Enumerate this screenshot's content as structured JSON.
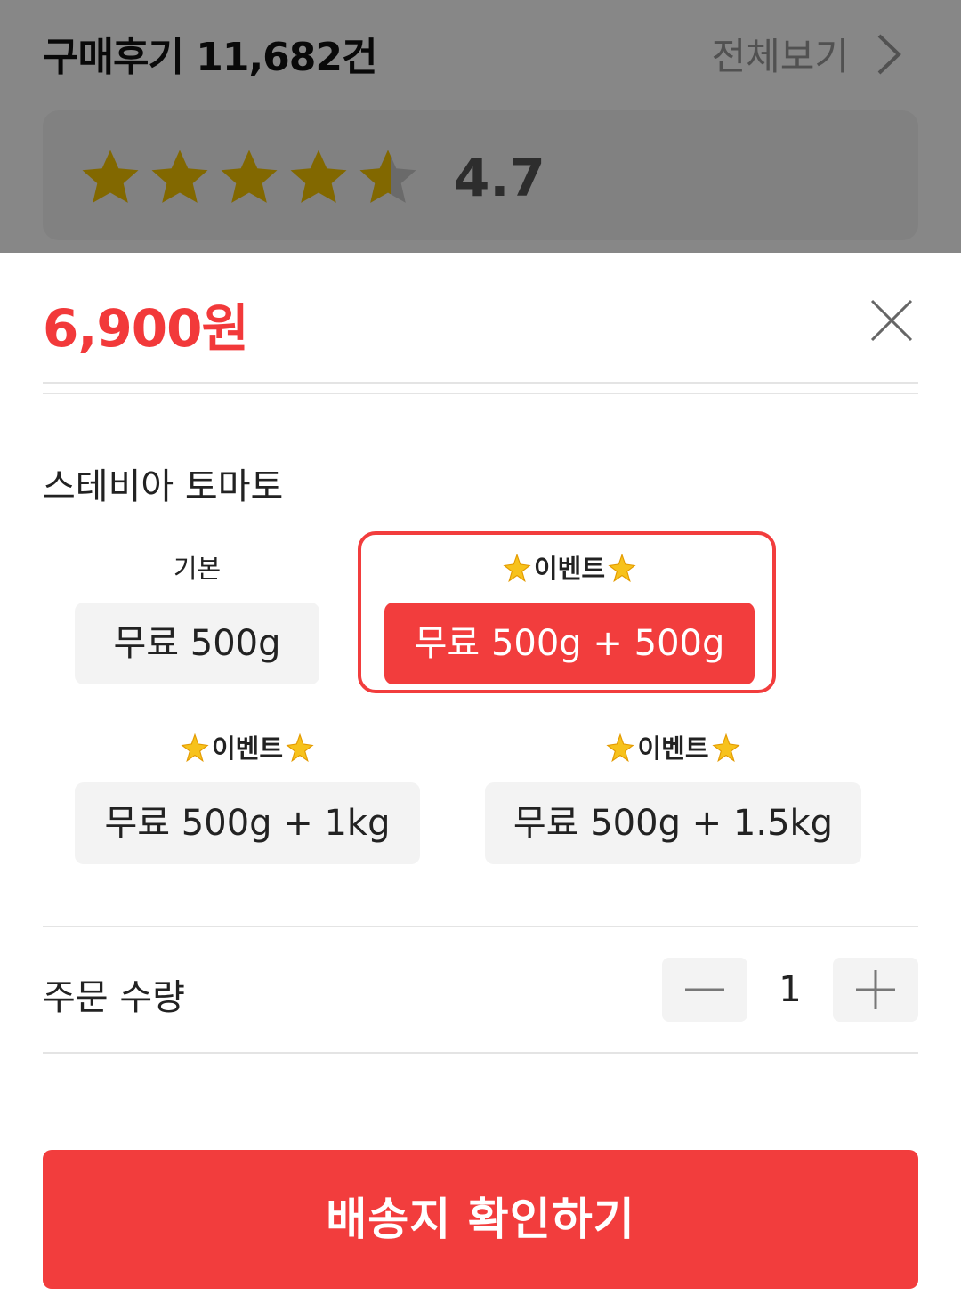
{
  "reviews": {
    "title": "구매후기 11,682건",
    "view_all": "전체보기",
    "rating": "4.7",
    "rating_stars": 4.7,
    "star_color": "#f5c400"
  },
  "sheet": {
    "price": "6,900원",
    "option_title": "스테비아 토마토",
    "options": [
      {
        "tag": "기본",
        "label": "무료 500g",
        "event": false,
        "selected": false
      },
      {
        "tag": "이벤트",
        "label": "무료 500g + 500g",
        "event": true,
        "selected": true
      },
      {
        "tag": "이벤트",
        "label": "무료 500g + 1kg",
        "event": true,
        "selected": false
      },
      {
        "tag": "이벤트",
        "label": "무료 500g + 1.5kg",
        "event": true,
        "selected": false
      }
    ],
    "quantity_label": "주문 수량",
    "quantity": "1",
    "confirm_label": "배송지 확인하기"
  },
  "colors": {
    "accent": "#f23d3d",
    "price": "#f2393a",
    "option_bg": "#f3f3f3"
  }
}
